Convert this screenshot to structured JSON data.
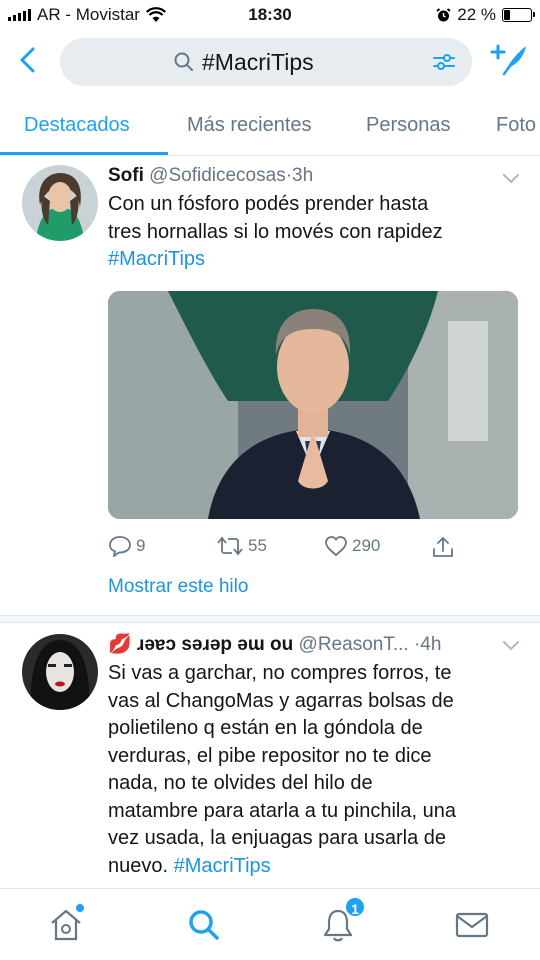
{
  "status_bar": {
    "carrier": "AR - Movistar",
    "time": "18:30",
    "battery": "22 %",
    "battery_level": 0.22
  },
  "search": {
    "query": "#MacriTips"
  },
  "tabs": [
    {
      "label": "Destacados",
      "active": true
    },
    {
      "label": "Más recientes",
      "active": false
    },
    {
      "label": "Personas",
      "active": false
    },
    {
      "label": "Foto",
      "active": false
    }
  ],
  "tweets": [
    {
      "name": "Sofi",
      "handle": "@Sofidicecosas",
      "separator": "·",
      "time": "3h",
      "text_lines": [
        "Con un fósforo podés prender hasta",
        "tres hornallas si lo movés con rapidez"
      ],
      "hashtag": "#MacriTips",
      "replies": "9",
      "retweets": "55",
      "likes": "290",
      "thread_link": "Mostrar este hilo"
    },
    {
      "name_emoji": "💋",
      "name": "ɹǝɐɔ sǝɹǝp ǝɯ ou",
      "handle": "@ReasonT...",
      "separator": "·",
      "time": "4h",
      "text_lines": [
        "Si vas a garchar, no compres forros, te",
        "vas al ChangoMas y agarras bolsas de",
        "polietileno q están en la góndola de",
        "verduras, el pibe repositor no te dice",
        "nada, no te olvides del hilo de",
        "matambre para atarla a tu pinchila, una",
        "vez usada, la enjuagas para usarla de"
      ],
      "last_line": "nuevo.",
      "hashtag": "#MacriTips"
    }
  ],
  "bottom_nav": {
    "notifications_count": "1"
  },
  "colors": {
    "accent": "#1da1f2",
    "link": "#1b95e0",
    "secondary_text": "#657786"
  }
}
